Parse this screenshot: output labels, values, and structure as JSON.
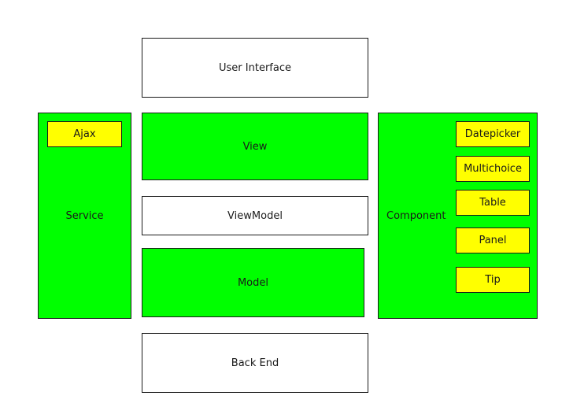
{
  "colors": {
    "green": "#00ff00",
    "yellow": "#ffff00",
    "white": "#ffffff",
    "border": "#1a1a1a"
  },
  "layers": {
    "user_interface": "User Interface",
    "view": "View",
    "viewmodel": "ViewModel",
    "model": "Model",
    "back_end": "Back End"
  },
  "service": {
    "label": "Service",
    "items": [
      "Ajax"
    ]
  },
  "component": {
    "label": "Component",
    "items": [
      "Datepicker",
      "Multichoice",
      "Table",
      "Panel",
      "Tip"
    ]
  }
}
